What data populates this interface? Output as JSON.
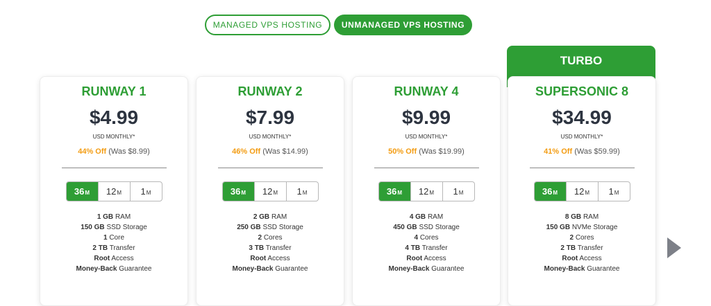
{
  "hosting_toggle": {
    "managed": "MANAGED VPS HOSTING",
    "unmanaged": "UNMANAGED VPS HOSTING"
  },
  "turbo_label": "TURBO",
  "colors": {
    "brand_green": "#2e9e35",
    "discount_orange": "#f39c12",
    "arrow_gray": "#7d8088"
  },
  "plans": [
    {
      "name": "RUNWAY 1",
      "price": "$4.99",
      "period": "USD MONTHLY*",
      "discount_pct": "44% Off",
      "was": "(Was $8.99)",
      "terms": [
        {
          "num": "36",
          "unit": "M"
        },
        {
          "num": "12",
          "unit": "M"
        },
        {
          "num": "1",
          "unit": "M"
        }
      ],
      "features": [
        {
          "bold": "1 GB",
          "text": "RAM"
        },
        {
          "bold": "150 GB",
          "text": "SSD Storage"
        },
        {
          "bold": "1",
          "text": "Core"
        },
        {
          "bold": "2 TB",
          "text": "Transfer"
        },
        {
          "bold": "Root",
          "text": "Access"
        },
        {
          "bold": "Money-Back",
          "text": "Guarantee"
        }
      ]
    },
    {
      "name": "RUNWAY 2",
      "price": "$7.99",
      "period": "USD MONTHLY*",
      "discount_pct": "46% Off",
      "was": "(Was $14.99)",
      "terms": [
        {
          "num": "36",
          "unit": "M"
        },
        {
          "num": "12",
          "unit": "M"
        },
        {
          "num": "1",
          "unit": "M"
        }
      ],
      "features": [
        {
          "bold": "2 GB",
          "text": "RAM"
        },
        {
          "bold": "250 GB",
          "text": "SSD Storage"
        },
        {
          "bold": "2",
          "text": "Cores"
        },
        {
          "bold": "3 TB",
          "text": "Transfer"
        },
        {
          "bold": "Root",
          "text": "Access"
        },
        {
          "bold": "Money-Back",
          "text": "Guarantee"
        }
      ]
    },
    {
      "name": "RUNWAY 4",
      "price": "$9.99",
      "period": "USD MONTHLY*",
      "discount_pct": "50% Off",
      "was": "(Was $19.99)",
      "terms": [
        {
          "num": "36",
          "unit": "M"
        },
        {
          "num": "12",
          "unit": "M"
        },
        {
          "num": "1",
          "unit": "M"
        }
      ],
      "features": [
        {
          "bold": "4 GB",
          "text": "RAM"
        },
        {
          "bold": "450 GB",
          "text": "SSD Storage"
        },
        {
          "bold": "4",
          "text": "Cores"
        },
        {
          "bold": "4 TB",
          "text": "Transfer"
        },
        {
          "bold": "Root",
          "text": "Access"
        },
        {
          "bold": "Money-Back",
          "text": "Guarantee"
        }
      ]
    },
    {
      "name": "SUPERSONIC 8",
      "price": "$34.99",
      "period": "USD MONTHLY*",
      "discount_pct": "41% Off",
      "was": "(Was $59.99)",
      "terms": [
        {
          "num": "36",
          "unit": "M"
        },
        {
          "num": "12",
          "unit": "M"
        },
        {
          "num": "1",
          "unit": "M"
        }
      ],
      "features": [
        {
          "bold": "8 GB",
          "text": "RAM"
        },
        {
          "bold": "150 GB",
          "text": "NVMe Storage"
        },
        {
          "bold": "2",
          "text": "Cores"
        },
        {
          "bold": "2 TB",
          "text": "Transfer"
        },
        {
          "bold": "Root",
          "text": "Access"
        },
        {
          "bold": "Money-Back",
          "text": "Guarantee"
        }
      ]
    }
  ],
  "next_arrow_icon": "chevron-right-icon"
}
